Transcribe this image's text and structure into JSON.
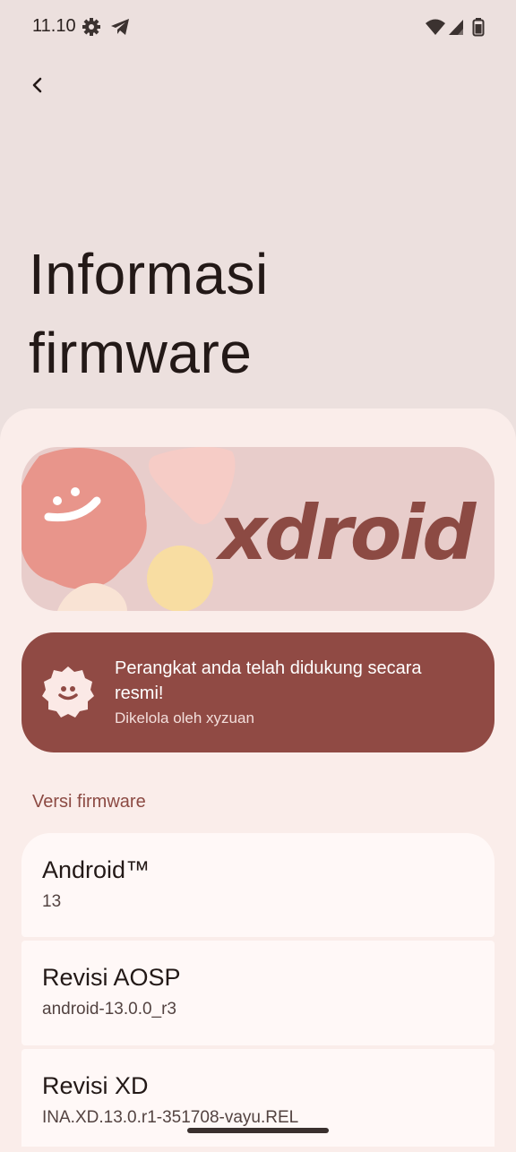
{
  "status_bar": {
    "time": "11.10",
    "icons": [
      "settings-icon",
      "telegram-icon",
      "wifi-icon",
      "signal-icon",
      "battery-icon"
    ]
  },
  "nav": {
    "back_icon": "back-arrow-icon"
  },
  "page": {
    "title_line1": "Informasi",
    "title_line2": "firmware"
  },
  "banner": {
    "logo_text": "xdroid"
  },
  "support": {
    "title": "Perangkat anda telah didukung secara resmi!",
    "subtitle": "Dikelola oleh xyzuan"
  },
  "section": {
    "header": "Versi firmware"
  },
  "items": [
    {
      "title": "Android™",
      "value": "13"
    },
    {
      "title": "Revisi AOSP",
      "value": "android-13.0.0_r3"
    },
    {
      "title": "Revisi XD",
      "value": "INA.XD.13.0.r1-351708-vayu.REL"
    }
  ],
  "colors": {
    "background": "#ECE0DE",
    "sheet": "#FAEDEA",
    "accent": "#904A44",
    "banner_bg": "#E8CDCB",
    "card": "#FFF8F7"
  }
}
